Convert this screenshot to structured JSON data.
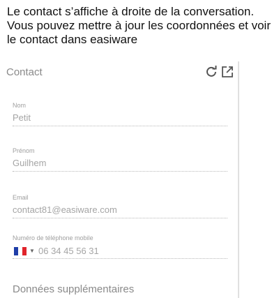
{
  "intro_text": "Le contact s’affiche à droite de la conversation. Vous pouvez mettre à jour les coordonnées et voir le contact dans easiware",
  "panel": {
    "title": "Contact",
    "icons": [
      "refresh-icon",
      "open-external-icon"
    ],
    "fields": {
      "nom": {
        "label": "Nom",
        "value": "Petit"
      },
      "prenom": {
        "label": "Prénom",
        "value": "Guilhem"
      },
      "email": {
        "label": "Email",
        "value": "contact81@easiware.com"
      },
      "telephone": {
        "label": "Numéro de téléphone mobile",
        "value": "06 34 45 56 31",
        "country_flag": "FR"
      }
    },
    "extra_section": "Données supplémentaires"
  },
  "colors": {
    "flag_blue": "#1f3ea8",
    "flag_white": "#ffffff",
    "flag_red": "#e0242b",
    "muted_text": "#8a8a8a"
  }
}
